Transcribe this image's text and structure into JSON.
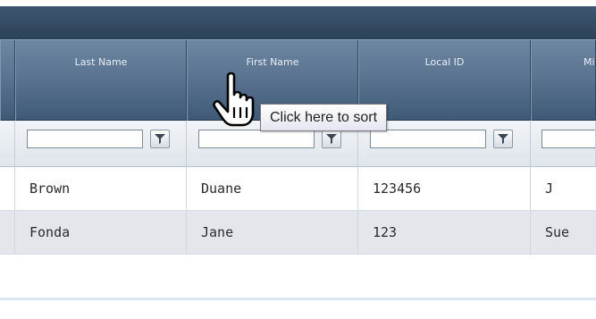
{
  "grid": {
    "columns": [
      {
        "label": "Last Name"
      },
      {
        "label": "First Name"
      },
      {
        "label": "Local ID"
      },
      {
        "label": "Mid"
      }
    ],
    "rows": [
      [
        "Brown",
        "Duane",
        "123456",
        "J"
      ],
      [
        "Fonda",
        "Jane",
        "123",
        "Sue"
      ]
    ]
  },
  "tooltip": {
    "text": "Click here to sort"
  },
  "icons": {
    "filter": "filter-funnel-icon",
    "cursor": "hand-pointer-icon"
  },
  "colors": {
    "header": "#58728f",
    "topbar": "#2c4258",
    "alt_row": "#e3e7ec"
  }
}
